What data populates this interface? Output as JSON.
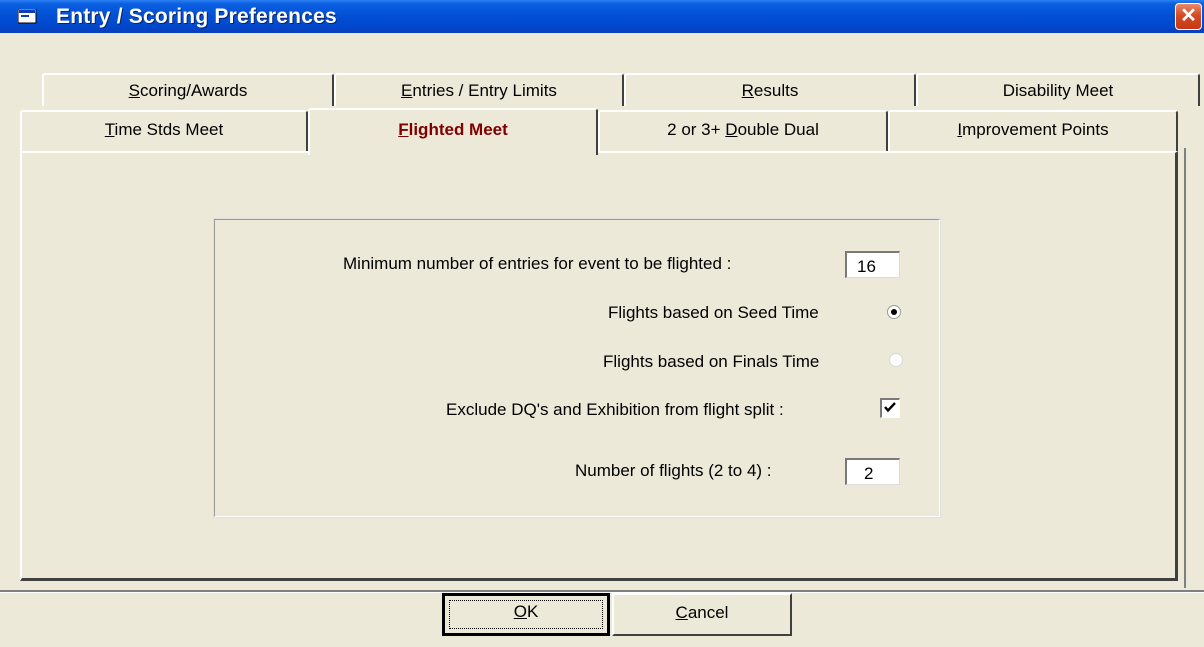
{
  "window": {
    "title": "Entry / Scoring Preferences",
    "close_glyph": "✕"
  },
  "tabs_back": [
    {
      "label": "Scoring/Awards",
      "mnemonic": "S",
      "rest": "coring/Awards"
    },
    {
      "label": "Entries / Entry Limits",
      "mnemonic": "E",
      "rest": "ntries / Entry Limits"
    },
    {
      "label": "Results",
      "mnemonic": "R",
      "rest": "esults"
    },
    {
      "label": "Disability Meet",
      "mnemonic": "",
      "rest": "Disability Meet"
    }
  ],
  "tabs_front": [
    {
      "label": "Time Stds Meet",
      "mnemonic": "T",
      "rest": "ime Stds Meet"
    },
    {
      "label": "Flighted Meet",
      "mnemonic": "F",
      "rest": "lighted Meet"
    },
    {
      "label": "2 or 3+ Double Dual",
      "pre": "2 or 3+ ",
      "mnemonic": "D",
      "rest": "ouble Dual"
    },
    {
      "label": "Improvement Points",
      "mnemonic": "I",
      "rest": "mprovement Points"
    }
  ],
  "form": {
    "min_entries_label": "Minimum number of entries for event to be flighted :",
    "min_entries_value": "16",
    "seed_time_label": "Flights based on Seed Time",
    "seed_time_selected": true,
    "finals_time_label": "Flights based on Finals Time",
    "finals_time_selected": false,
    "exclude_label": "Exclude DQ's and Exhibition from flight split :",
    "exclude_checked": true,
    "num_flights_label": "Number of flights (2 to 4) :",
    "num_flights_value": "2"
  },
  "buttons": {
    "ok": {
      "label": "OK",
      "mnemonic": "O",
      "rest": "K"
    },
    "cancel": {
      "label": "Cancel",
      "mnemonic": "C",
      "rest": "ancel"
    }
  }
}
